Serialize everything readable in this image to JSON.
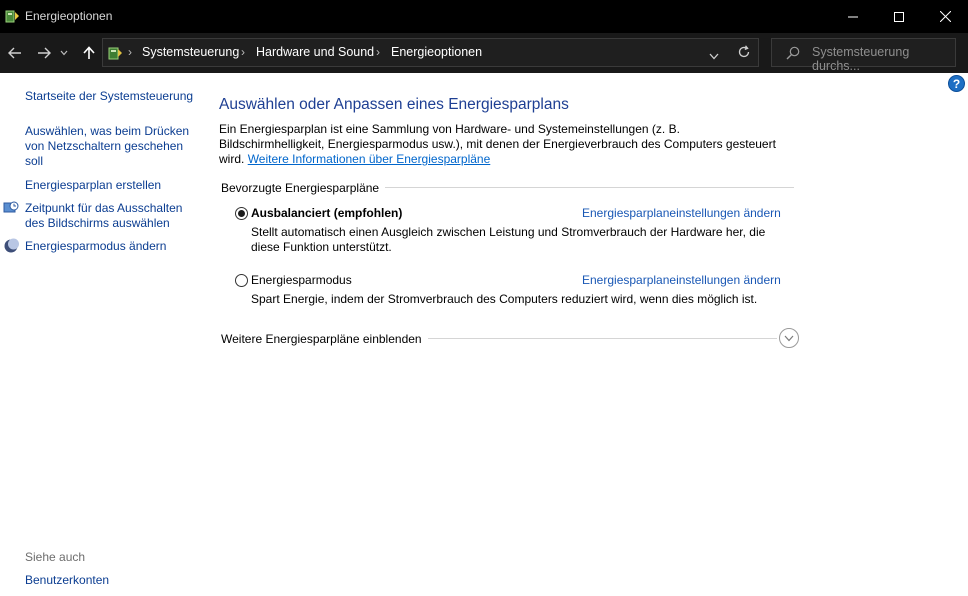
{
  "window": {
    "title": "Energieoptionen"
  },
  "address_bar": {
    "breadcrumbs": [
      "Systemsteuerung",
      "Hardware und Sound",
      "Energieoptionen"
    ]
  },
  "search": {
    "placeholder": "Systemsteuerung durchs..."
  },
  "sidebar": {
    "items": [
      {
        "label": "Startseite der Systemsteuerung"
      },
      {
        "label": "Auswählen, was beim Drücken von Netzschaltern geschehen soll"
      },
      {
        "label": "Energiesparplan erstellen"
      },
      {
        "label": "Zeitpunkt für das Ausschalten des Bildschirms auswählen"
      },
      {
        "label": "Energiesparmodus ändern"
      }
    ],
    "see_also": "Siehe auch",
    "see_also_items": [
      {
        "label": "Benutzerkonten"
      }
    ]
  },
  "main": {
    "title": "Auswählen oder Anpassen eines Energiesparplans",
    "intro_text": "Ein Energiesparplan ist eine Sammlung von Hardware- und Systemeinstellungen (z. B. Bildschirmhelligkeit, Energiesparmodus usw.), mit denen der Energieverbrauch des Computers gesteuert wird.",
    "intro_link": "Weitere Informationen über Energiesparpläne",
    "section_title": "Bevorzugte Energiesparpläne",
    "plans": [
      {
        "name": "Ausbalanciert (empfohlen)",
        "selected": true,
        "settings_link": "Energiesparplaneinstellungen ändern",
        "description": "Stellt automatisch einen Ausgleich zwischen Leistung und Stromverbrauch der Hardware her, die diese Funktion unterstützt."
      },
      {
        "name": "Energiesparmodus",
        "selected": false,
        "settings_link": "Energiesparplaneinstellungen ändern",
        "description": "Spart Energie, indem der Stromverbrauch des Computers reduziert wird, wenn dies möglich ist."
      }
    ],
    "more_plans": "Weitere Energiesparpläne einblenden"
  },
  "help_icon_glyph": "?",
  "colors": {
    "titlebar_bg": "#000000",
    "navbar_bg": "#191919",
    "heading_blue": "#1e3f93",
    "link_blue": "#0066cc"
  },
  "icons": {
    "app": "power-options-icon",
    "back": "arrow-left-icon",
    "forward": "arrow-right-icon",
    "recent": "chevron-down-icon",
    "up": "arrow-up-icon",
    "refresh": "refresh-icon",
    "search": "search-icon",
    "help": "help-icon",
    "expand": "chevron-down-circle-icon"
  }
}
